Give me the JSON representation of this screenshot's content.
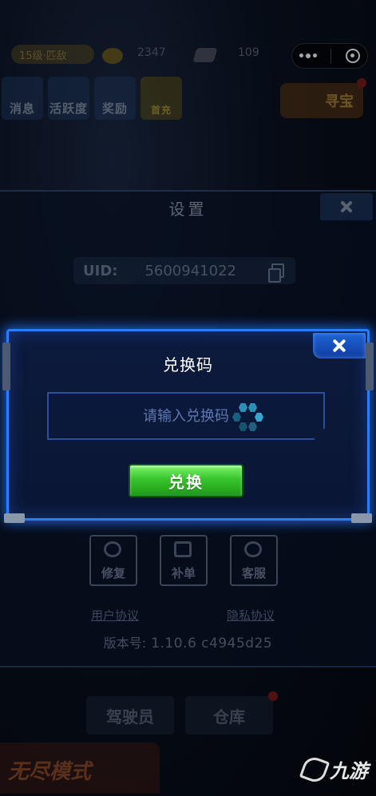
{
  "topbar": {
    "level_text": "15级·匹敌",
    "coins": "2347",
    "gems": "109"
  },
  "menu": {
    "items": [
      {
        "label": "消息"
      },
      {
        "label": "活跃度"
      },
      {
        "label": "奖励"
      },
      {
        "label": "首充"
      }
    ],
    "treasure_label": "寻宝"
  },
  "settings": {
    "title": "设置",
    "uid_label": "UID:",
    "uid_value": "5600941022",
    "tools": [
      {
        "label": "修复",
        "icon": "wrench-icon"
      },
      {
        "label": "补单",
        "icon": "document-icon"
      },
      {
        "label": "客服",
        "icon": "headset-icon"
      }
    ],
    "user_agreement": "用户协议",
    "privacy_policy": "隐私协议",
    "version_label": "版本号:",
    "version_value": "1.10.6   c4945d25"
  },
  "bottom": {
    "pilot_label": "驾驶员",
    "warehouse_label": "仓库",
    "endless_label": "无尽模式"
  },
  "dialog": {
    "title": "兑换码",
    "input_placeholder": "请输入兑换码",
    "input_value": "",
    "redeem_label": "兑换"
  },
  "watermark": {
    "text": "九游"
  },
  "colors": {
    "dialog_border": "#2a7dff",
    "redeem_green": "#38c42c",
    "close_blue": "#1f63d8"
  }
}
